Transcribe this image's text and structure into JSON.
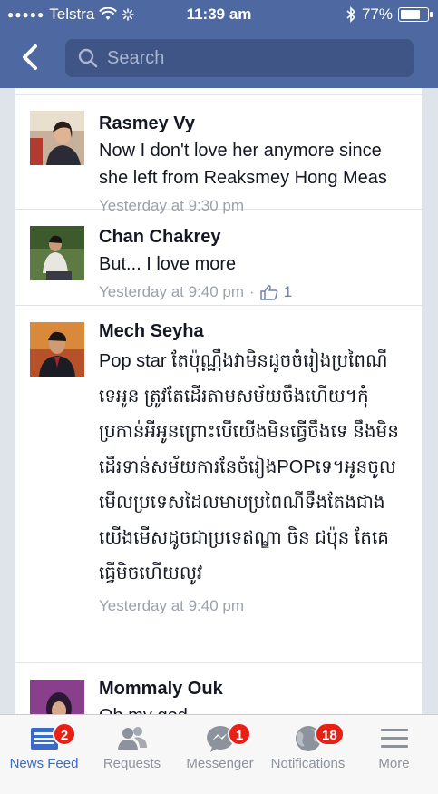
{
  "status_bar": {
    "carrier": "Telstra",
    "time": "11:39 am",
    "battery_percent": "77%",
    "battery_level": 0.77
  },
  "search": {
    "placeholder": "Search"
  },
  "comments": [
    {
      "author": "Rasmey Vy",
      "text": "Now I don't love her anymore since she left from Reaksmey Hong Meas",
      "time": "Yesterday at 9:30 pm"
    },
    {
      "author": "Chan Chakrey",
      "text": "But... I love more",
      "time": "Yesterday at 9:40 pm",
      "separator": "·",
      "likes": "1"
    },
    {
      "author": "Mech Seyha",
      "text": "Pop star តែប៉ុណ្ណឹងវាមិនដូចចំរៀងប្រពៃណីទេអូន ត្រូវតែដើរតាមសម័យចឹងហើយ។កុំប្រកាន់អីអូនព្រោះបើយើងមិនធ្វើចឹងទេ នឹងមិនដើរទាន់សម័យការនែចំរៀងPOPទេ។អូនចូលមើលប្រទេសដៃលមាបប្រពៃណីទឹងតែងជាងយើងមើសដូចជាប្រទេឥណ្ឌា ចិន ជប៉ុន តែគេធ្វើមិចហើយលូវ",
      "time": "Yesterday at 9:40 pm"
    },
    {
      "author": "Mommaly Ouk",
      "text": "Oh my god"
    }
  ],
  "tabs": [
    {
      "label": "News Feed",
      "badge": "2",
      "icon": "news-feed-icon",
      "active": true
    },
    {
      "label": "Requests",
      "icon": "requests-icon"
    },
    {
      "label": "Messenger",
      "badge": "1",
      "icon": "messenger-icon"
    },
    {
      "label": "Notifications",
      "badge": "18",
      "icon": "globe-icon"
    },
    {
      "label": "More",
      "icon": "menu-icon"
    }
  ],
  "colors": {
    "header": "#4e69a2",
    "badge": "#e82016",
    "active_tab": "#3b6bc8",
    "meta_text": "#9ba1ab"
  }
}
